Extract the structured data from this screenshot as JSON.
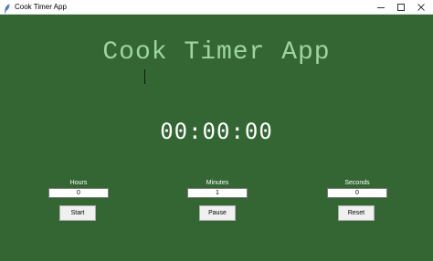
{
  "window": {
    "title": "Cook Timer App",
    "icon": "feather-icon",
    "controls": [
      "minimize-icon",
      "maximize-icon",
      "close-icon"
    ]
  },
  "app": {
    "heading": "Cook Timer App",
    "display": "00:00:00"
  },
  "fields": {
    "hours": {
      "label": "Hours",
      "value": "0"
    },
    "minutes": {
      "label": "Minutes",
      "value": "1"
    },
    "seconds": {
      "label": "Seconds",
      "value": "0"
    }
  },
  "buttons": {
    "start": "Start",
    "pause": "Pause",
    "reset": "Reset"
  },
  "colors": {
    "background": "#336633",
    "heading": "#9fd49f",
    "display": "#ffffff"
  }
}
